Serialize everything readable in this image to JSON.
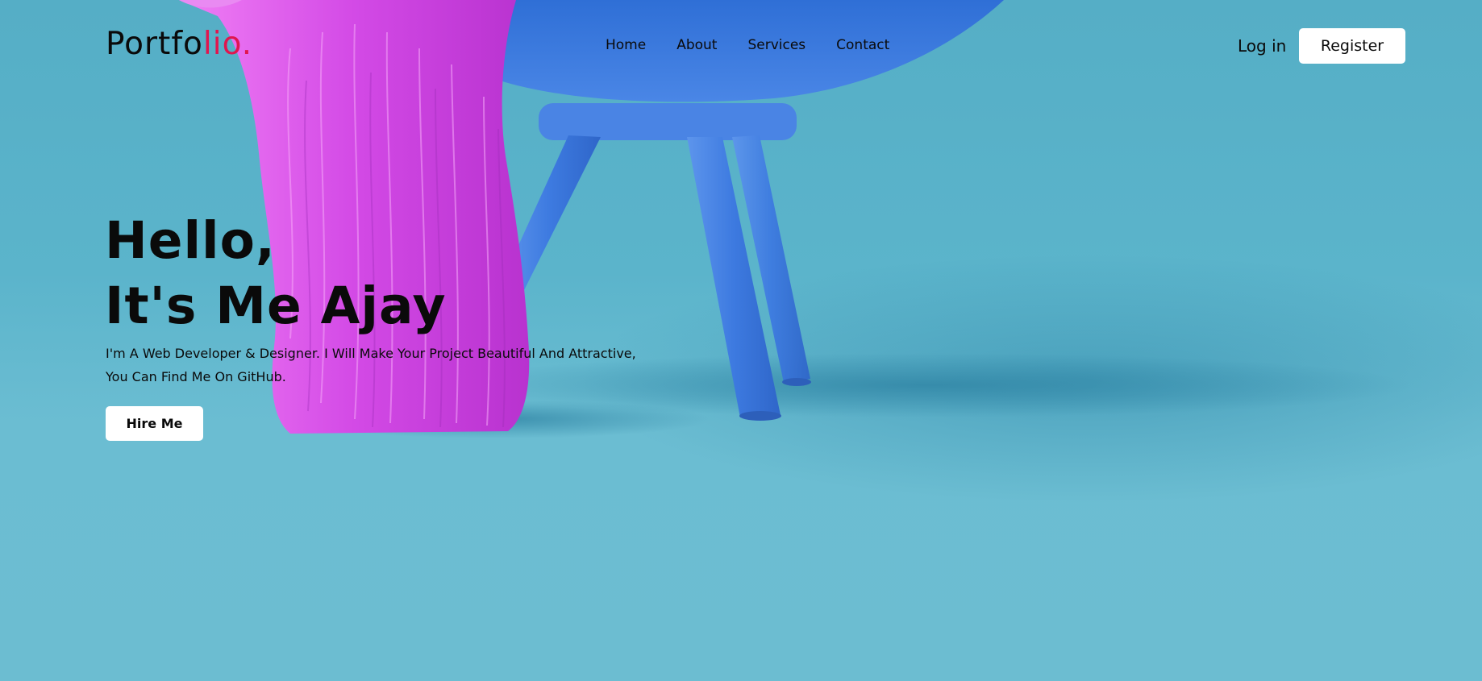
{
  "brand": {
    "logo_main": "Portfo",
    "logo_accent": "lio.",
    "accent_color": "#e0164f"
  },
  "nav": {
    "items": [
      "Home",
      "About",
      "Services",
      "Contact"
    ]
  },
  "auth": {
    "login_label": "Log in",
    "register_label": "Register"
  },
  "hero": {
    "title_line1": "Hello,",
    "title_line2": "It's Me Ajay",
    "description_line1": "I'm A Web Developer & Designer. I Will Make Your Project Beautiful And Attractive,",
    "description_line2": "You Can Find Me On GitHub.",
    "cta_label": "Hire Me"
  },
  "colors": {
    "background": "#64b8cf",
    "chair": "#3e7fe0",
    "fur": "#d84ce6"
  }
}
